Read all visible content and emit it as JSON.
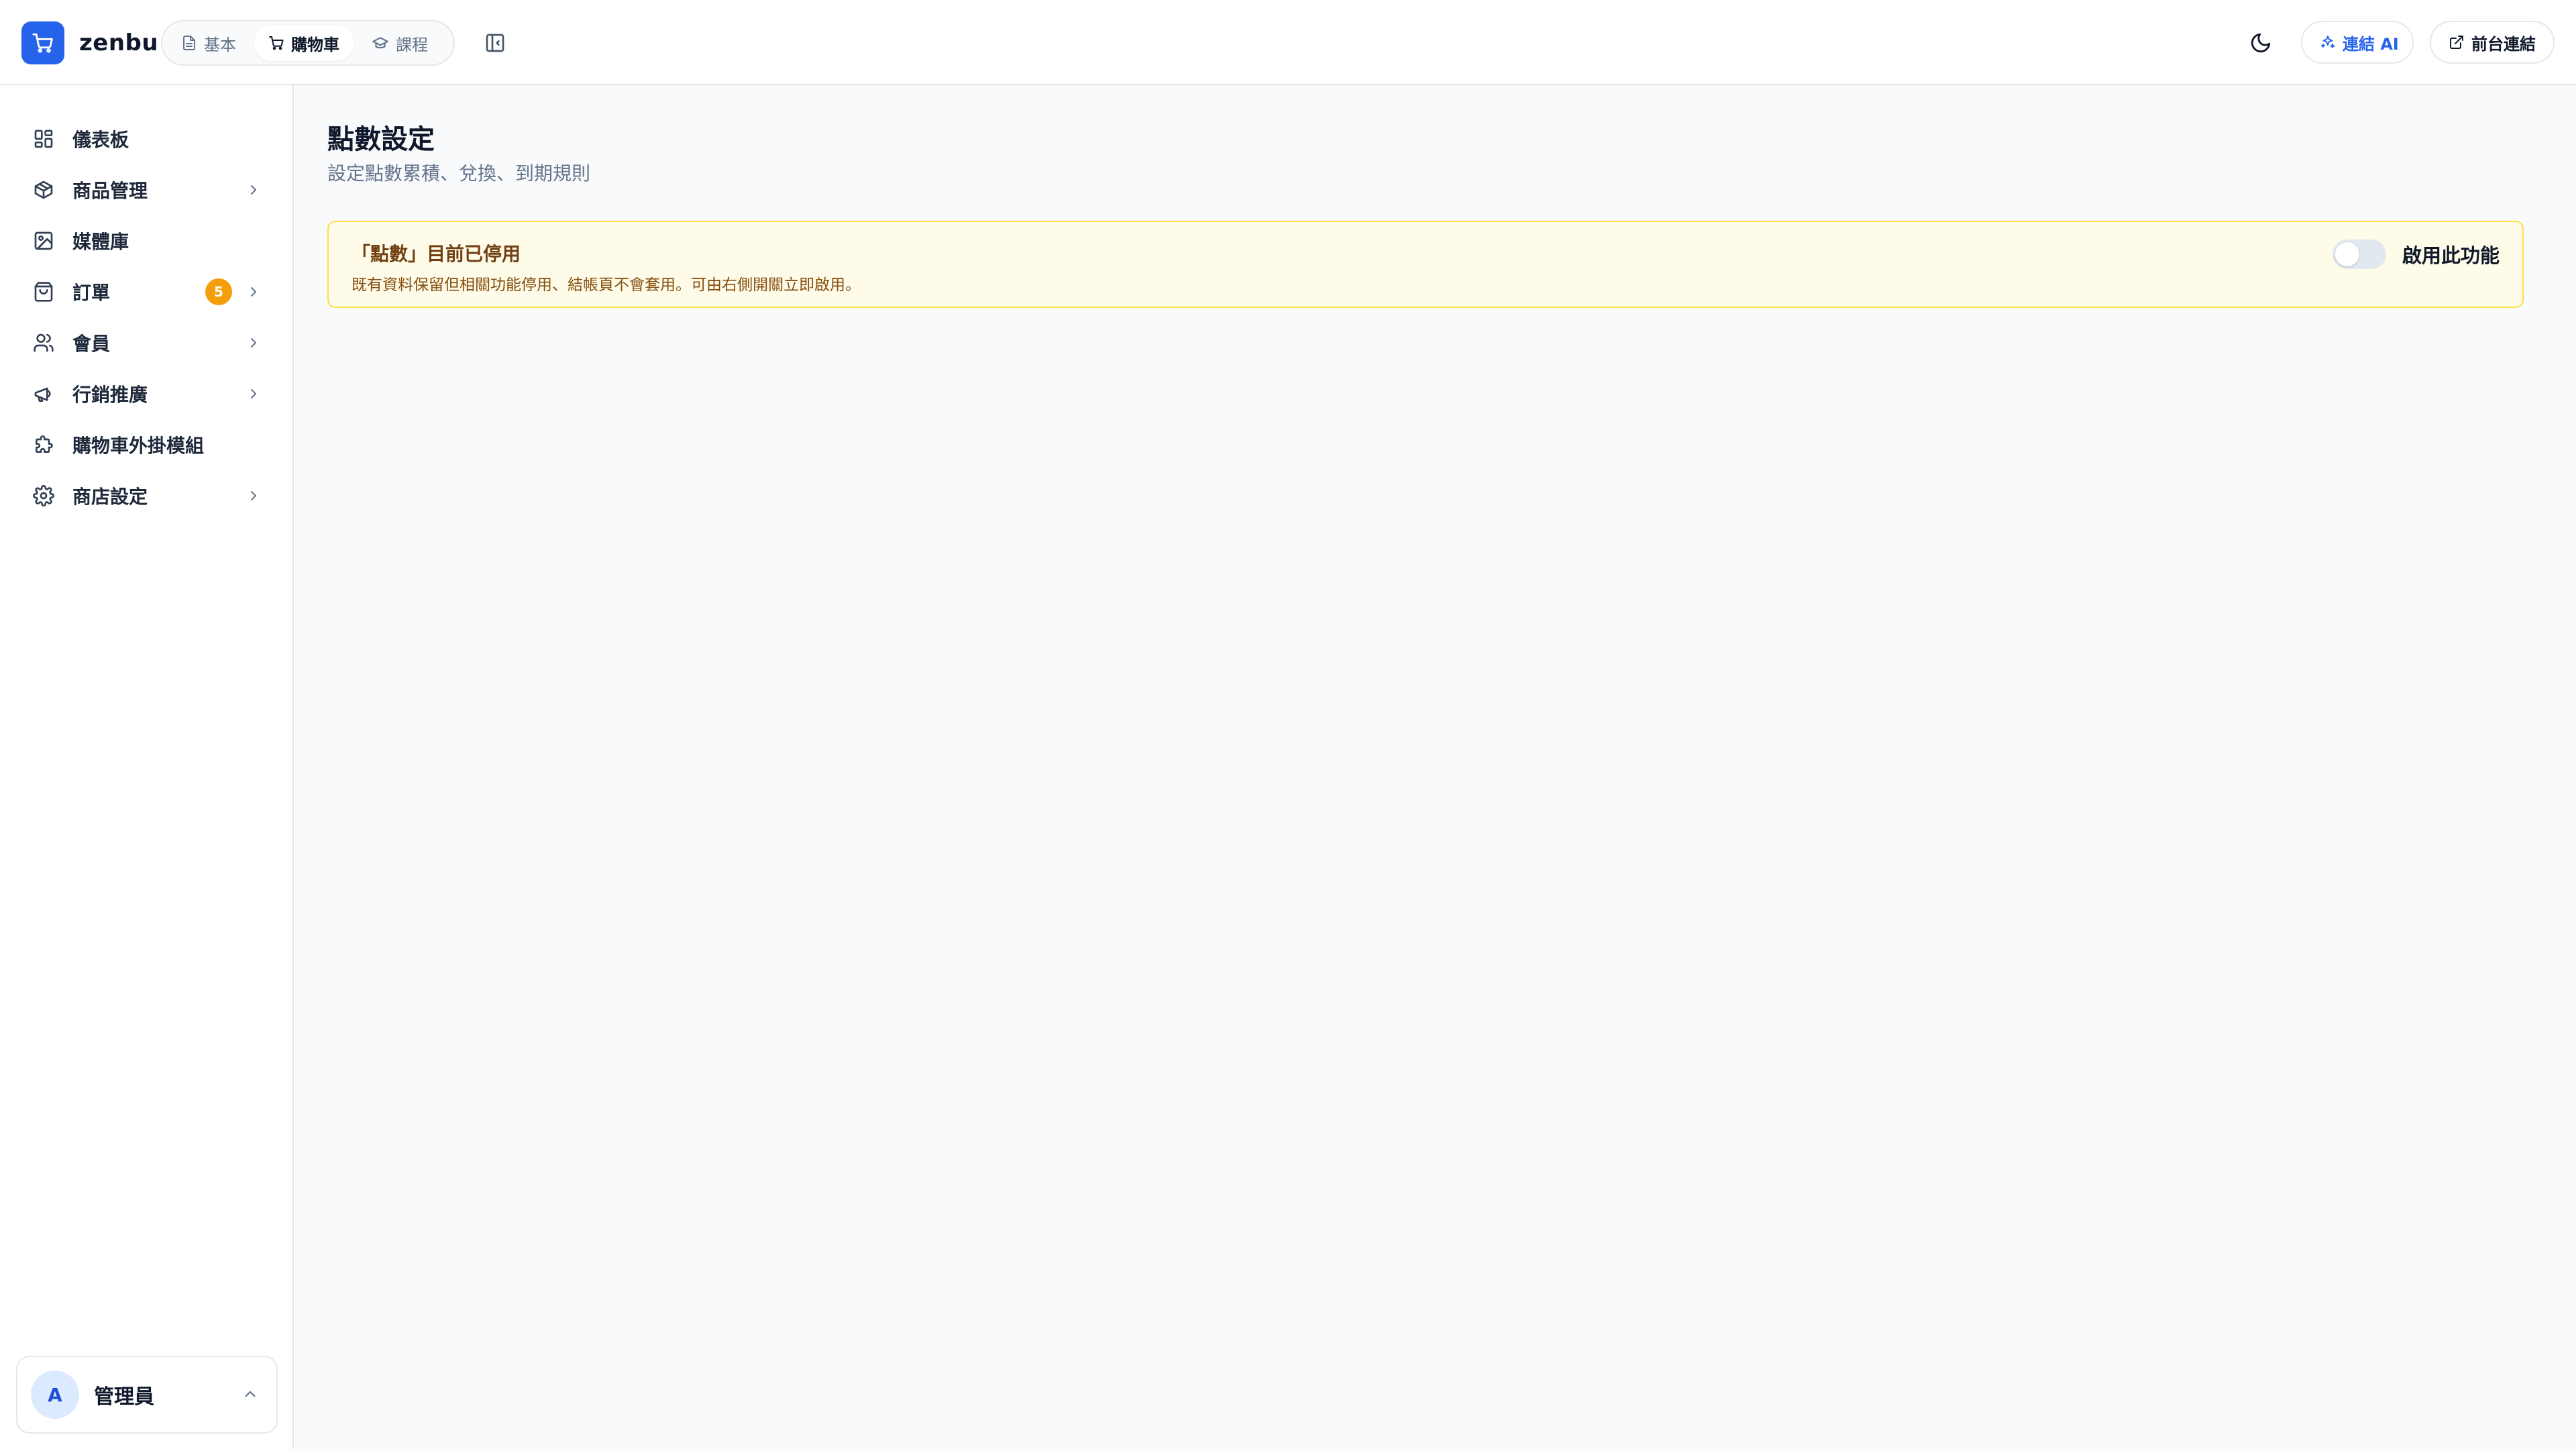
{
  "brand": {
    "name": "zenbu"
  },
  "header": {
    "mode_tabs": [
      {
        "label": "基本",
        "icon": "file-icon"
      },
      {
        "label": "購物車",
        "icon": "cart-icon",
        "active": true
      },
      {
        "label": "課程",
        "icon": "graduation-cap-icon"
      }
    ],
    "connect_ai_label": "連結 AI",
    "frontend_link_label": "前台連結"
  },
  "sidebar": {
    "items": [
      {
        "label": "儀表板",
        "icon": "dashboard-icon"
      },
      {
        "label": "商品管理",
        "icon": "package-icon",
        "has_children": true
      },
      {
        "label": "媒體庫",
        "icon": "image-icon"
      },
      {
        "label": "訂單",
        "icon": "shopping-bag-icon",
        "badge": "5",
        "has_children": true
      },
      {
        "label": "會員",
        "icon": "users-icon",
        "has_children": true
      },
      {
        "label": "行銷推廣",
        "icon": "megaphone-icon",
        "has_children": true
      },
      {
        "label": "購物車外掛模組",
        "icon": "puzzle-icon"
      },
      {
        "label": "商店設定",
        "icon": "gear-icon",
        "has_children": true
      }
    ],
    "user": {
      "initial": "A",
      "name": "管理員"
    }
  },
  "main": {
    "title": "點數設定",
    "subtitle": "設定點數累積、兌換、到期規則",
    "notice": {
      "title": "「點數」目前已停用",
      "description": "既有資料保留但相關功能停用、結帳頁不會套用。可由右側開關立即啟用。",
      "toggle_label": "啟用此功能",
      "toggle_on": false
    }
  },
  "colors": {
    "accent": "#2563eb",
    "badge": "#f59e0b",
    "notice_bg": "#fefce8",
    "notice_border": "#fde047"
  }
}
